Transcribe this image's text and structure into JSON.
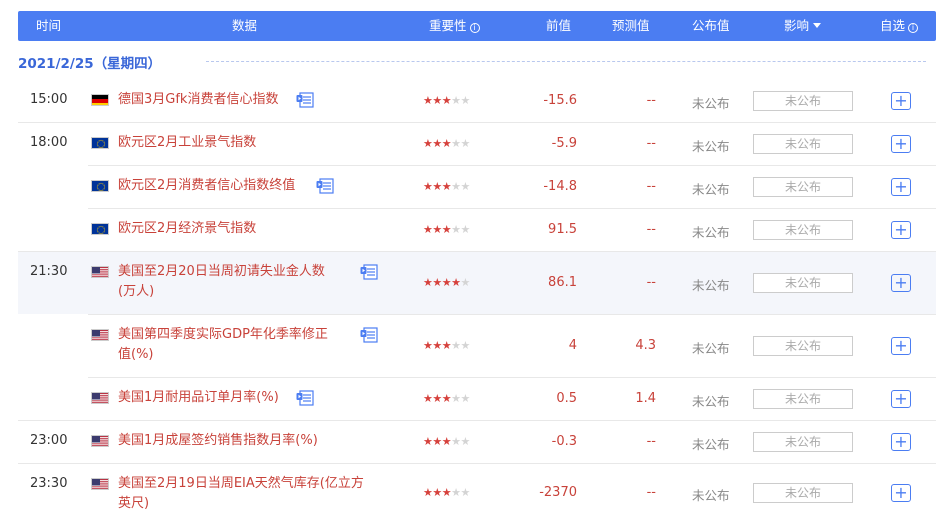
{
  "header": {
    "time": "时间",
    "data": "数据",
    "importance": "重要性",
    "previous": "前值",
    "forecast": "预测值",
    "actual": "公布值",
    "impact": "影响",
    "watchlist": "自选"
  },
  "date_label": "2021/2/25（星期四）",
  "rows": [
    {
      "time": "15:00",
      "country": "germany",
      "title": "德国3月Gfk消费者信心指数",
      "stars": 3,
      "has_doc": true,
      "previous": "-15.6",
      "forecast": "--",
      "actual": "未公布",
      "impact": "未公布"
    },
    {
      "time": "18:00",
      "country": "eu",
      "title": "欧元区2月工业景气指数",
      "stars": 3,
      "has_doc": false,
      "previous": "-5.9",
      "forecast": "--",
      "actual": "未公布",
      "impact": "未公布"
    },
    {
      "time": "",
      "country": "eu",
      "title": "欧元区2月消费者信心指数终值",
      "stars": 3,
      "has_doc": true,
      "previous": "-14.8",
      "forecast": "--",
      "actual": "未公布",
      "impact": "未公布"
    },
    {
      "time": "",
      "country": "eu",
      "title": "欧元区2月经济景气指数",
      "stars": 3,
      "has_doc": false,
      "previous": "91.5",
      "forecast": "--",
      "actual": "未公布",
      "impact": "未公布"
    },
    {
      "time": "21:30",
      "country": "usa",
      "title_line1": "美国至2月20日当周初请失业金人数",
      "title_line2": "(万人)",
      "stars": 4,
      "has_doc": true,
      "previous": "86.1",
      "forecast": "--",
      "actual": "未公布",
      "impact": "未公布"
    },
    {
      "time": "",
      "country": "usa",
      "title_line1": "美国第四季度实际GDP年化季率修正",
      "title_line2": "值(%)",
      "stars": 3,
      "has_doc": true,
      "previous": "4",
      "forecast": "4.3",
      "actual": "未公布",
      "impact": "未公布"
    },
    {
      "time": "",
      "country": "usa",
      "title": "美国1月耐用品订单月率(%)",
      "stars": 3,
      "has_doc": true,
      "previous": "0.5",
      "forecast": "1.4",
      "actual": "未公布",
      "impact": "未公布"
    },
    {
      "time": "23:00",
      "country": "usa",
      "title": "美国1月成屋签约销售指数月率(%)",
      "stars": 3,
      "has_doc": false,
      "previous": "-0.3",
      "forecast": "--",
      "actual": "未公布",
      "impact": "未公布"
    },
    {
      "time": "23:30",
      "country": "usa",
      "title_line1": "美国至2月19日当周EIA天然气库存(亿立方",
      "title_line2": "英尺)",
      "stars": 3,
      "has_doc": false,
      "previous": "-2370",
      "forecast": "--",
      "actual": "未公布",
      "impact": "未公布"
    }
  ],
  "colors": {
    "header_bg": "#4b7df2",
    "value_red": "#c8423a",
    "star_on": "#d6413c"
  }
}
